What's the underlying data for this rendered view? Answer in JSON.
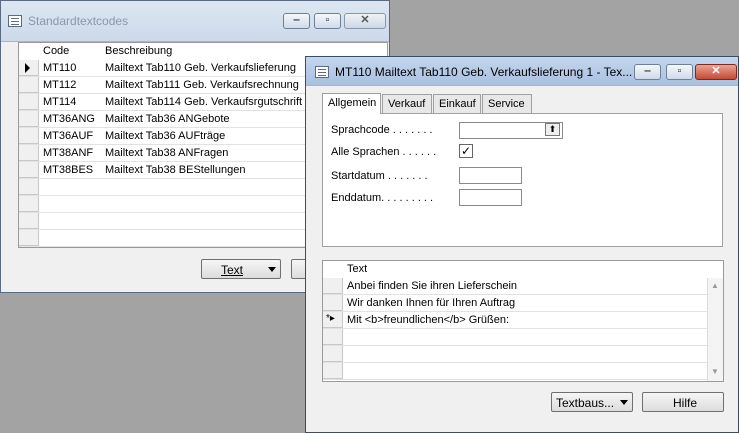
{
  "back_window": {
    "title": "Standardtextcodes",
    "columns": {
      "code": "Code",
      "description": "Beschreibung"
    },
    "rows": [
      {
        "code": "MT110",
        "description": "Mailtext Tab110 Geb. Verkaufslieferung"
      },
      {
        "code": "MT112",
        "description": "Mailtext Tab111 Geb. Verkaufsrechnung"
      },
      {
        "code": "MT114",
        "description": "Mailtext Tab114 Geb. Verkaufsrgutschrift"
      },
      {
        "code": "MT36ANG",
        "description": "Mailtext Tab36 ANGebote"
      },
      {
        "code": "MT36AUF",
        "description": "Mailtext Tab36 AUFträge"
      },
      {
        "code": "MT38ANF",
        "description": "Mailtext Tab38 ANFragen"
      },
      {
        "code": "MT38BES",
        "description": "Mailtext Tab38 BEStellungen"
      }
    ],
    "text_button": "Text"
  },
  "front_window": {
    "title": "MT110 Mailtext Tab110 Geb. Verkaufslieferung  1 - Tex...",
    "tabs": [
      "Allgemein",
      "Verkauf",
      "Einkauf",
      "Service"
    ],
    "fields": {
      "sprachcode": "Sprachcode . . . . . . .",
      "alle_sprachen": "Alle Sprachen . . . . . .",
      "alle_sprachen_checked": true,
      "startdatum": "Startdatum . . . . . . .",
      "enddatum": "Enddatum. . . . . . . . ."
    },
    "lines_header": "Text",
    "lines": [
      "Anbei finden Sie ihren Lieferschein",
      "Wir danken Ihnen für Ihren Auftrag",
      "Mit <b>freundlichen</b> Grüßen:"
    ],
    "new_row_marker": "*▸",
    "textbaus_button": "Textbaus...",
    "hilfe_button": "Hilfe"
  }
}
